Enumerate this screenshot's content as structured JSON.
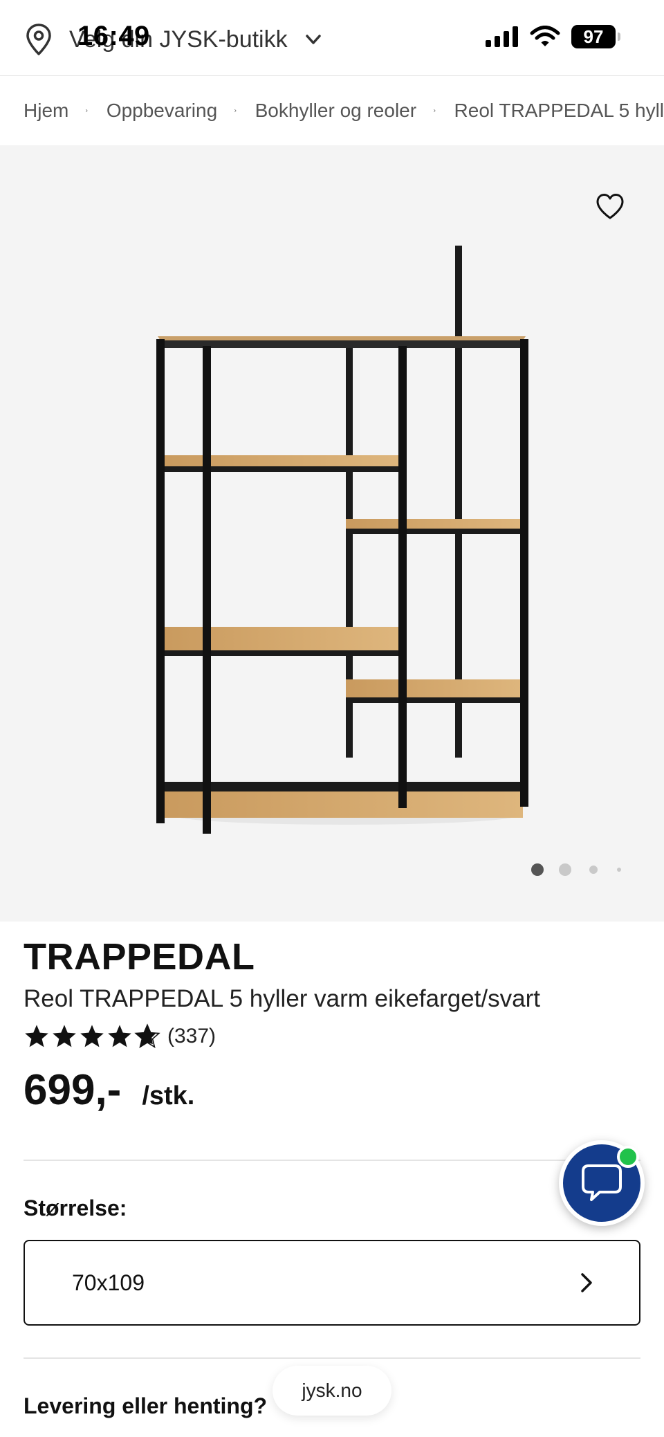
{
  "status_bar": {
    "time": "16:49",
    "battery": "97"
  },
  "header": {
    "store_prompt": "Velg din JYSK-butikk"
  },
  "breadcrumb": [
    "Hjem",
    "Oppbevaring",
    "Bokhyller og reoler",
    "Reol TRAPPEDAL 5 hyll"
  ],
  "gallery": {
    "dots_count": 4,
    "active_index": 0
  },
  "product": {
    "brand": "TRAPPEDAL",
    "name": "Reol TRAPPEDAL 5 hyller varm eikefarget/svart",
    "rating": 4.5,
    "reviews": "(337)",
    "price": "699,-",
    "unit": "/stk."
  },
  "size": {
    "label": "Størrelse:",
    "value": "70x109"
  },
  "delivery": {
    "label": "Levering eller henting?"
  },
  "browser": {
    "url": "jysk.no"
  },
  "colors": {
    "chat": "#143c8c",
    "online": "#21c24b",
    "gallery_bg": "#f4f4f4"
  },
  "icons": [
    "location-pin-icon",
    "chevron-down-icon",
    "signal-icon",
    "wifi-icon",
    "battery-icon",
    "breadcrumb-chevron-icon",
    "heart-icon",
    "star-icon",
    "chevron-right-icon",
    "chat-icon"
  ]
}
